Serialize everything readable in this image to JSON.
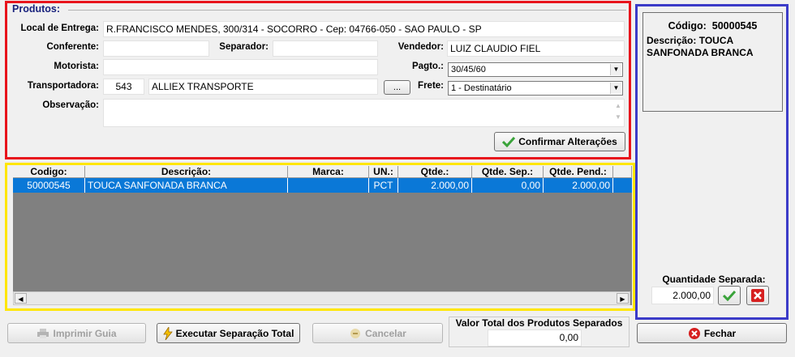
{
  "section": {
    "title": "Produtos:"
  },
  "form": {
    "local_entrega": {
      "label": "Local de Entrega:",
      "value": "R.FRANCISCO MENDES, 300/314 - SOCORRO - Cep: 04766-050 - SAO PAULO - SP"
    },
    "conferente": {
      "label": "Conferente:",
      "value": ""
    },
    "separador": {
      "label": "Separador:",
      "value": ""
    },
    "vendedor": {
      "label": "Vendedor:",
      "value": "LUIZ CLAUDIO FIEL"
    },
    "motorista": {
      "label": "Motorista:",
      "value": ""
    },
    "pagto": {
      "label": "Pagto.:",
      "value": "30/45/60"
    },
    "transportadora": {
      "label": "Transportadora:",
      "code": "543",
      "name": "ALLIEX TRANSPORTE",
      "lookup_label": "..."
    },
    "frete": {
      "label": "Frete:",
      "value": "1 - Destinatário"
    },
    "observacao": {
      "label": "Observação:",
      "value": ""
    },
    "confirm_label": "Confirmar Alterações"
  },
  "grid": {
    "columns": [
      "Codigo:",
      "Descrição:",
      "Marca:",
      "UN.:",
      "Qtde.:",
      "Qtde. Sep.:",
      "Qtde. Pend.:"
    ],
    "rows": [
      {
        "codigo": "50000545",
        "descricao": "TOUCA SANFONADA BRANCA",
        "marca": "",
        "un": "PCT",
        "qtde": "2.000,00",
        "qtde_sep": "0,00",
        "qtde_pend": "2.000,00"
      }
    ]
  },
  "side": {
    "codigo_label": "Código:",
    "codigo_value": "50000545",
    "descricao_label": "Descrição:",
    "descricao_value": "TOUCA SANFONADA BRANCA",
    "qtd_label": "Quantidade Separada:",
    "qtd_value": "2.000,00"
  },
  "footer": {
    "print_label": "Imprimir Guia",
    "exec_label": "Executar Separação Total",
    "cancel_label": "Cancelar",
    "total_label": "Valor Total dos Produtos Separados",
    "total_value": "0,00",
    "close_label": "Fechar"
  },
  "icons": {
    "confirm": "check-icon",
    "print": "printer-icon",
    "exec": "lightning-icon",
    "cancel": "cancel-icon",
    "close": "close-icon"
  },
  "colors": {
    "selection": "#0a78d7",
    "red_box": "#e8141c",
    "yellow_box": "#ffe600",
    "blue_box": "#3b3bc8"
  }
}
